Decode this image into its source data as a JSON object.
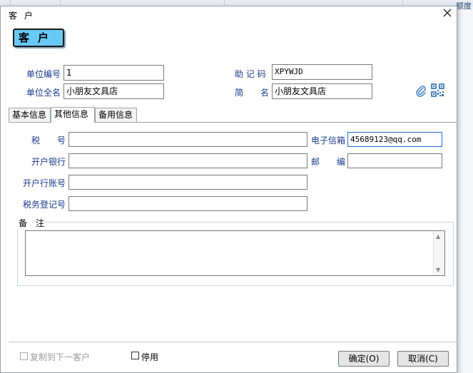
{
  "background": {
    "right_text": "额度"
  },
  "dialog": {
    "title": "客 户",
    "close_glyph": "✕"
  },
  "banner": {
    "label": "客户"
  },
  "header": {
    "unit_code_label": "单位编号",
    "unit_code_value": "1",
    "unit_fullname_label": "单位全名",
    "unit_fullname_value": "小朋友文具店",
    "mnemonic_label": "助 记 码",
    "mnemonic_value": "XPYWJD",
    "short_name_label": "简　　名",
    "short_name_value": "小朋友文具店"
  },
  "icons": {
    "attach": "paperclip-icon",
    "qr": "qr-code-icon"
  },
  "tabs": [
    {
      "label": "基本信息",
      "active": false
    },
    {
      "label": "其他信息",
      "active": true
    },
    {
      "label": "备用信息",
      "active": false
    }
  ],
  "other_info": {
    "tax_no_label": "税　　号",
    "tax_no_value": "",
    "email_label": "电子信箱",
    "email_value": "45689123@qq.com",
    "bank_label": "开户银行",
    "bank_value": "",
    "zip_label": "邮　　编",
    "zip_value": "",
    "bank_account_label": "开户行账号",
    "bank_account_value": "",
    "tax_reg_label": "税务登记号",
    "tax_reg_value": "",
    "remark_label": "备　注",
    "remark_value": ""
  },
  "footer": {
    "copy_next_label": "复制到下一客户",
    "disable_label": "停用",
    "ok_label": "确定(O)",
    "cancel_label": "取消(C)"
  },
  "colors": {
    "label_blue": "#1a3a8c",
    "banner_bg": "#69c9f6",
    "active_input_border": "#1e6fd9",
    "attach_icon": "#3b83c5"
  }
}
